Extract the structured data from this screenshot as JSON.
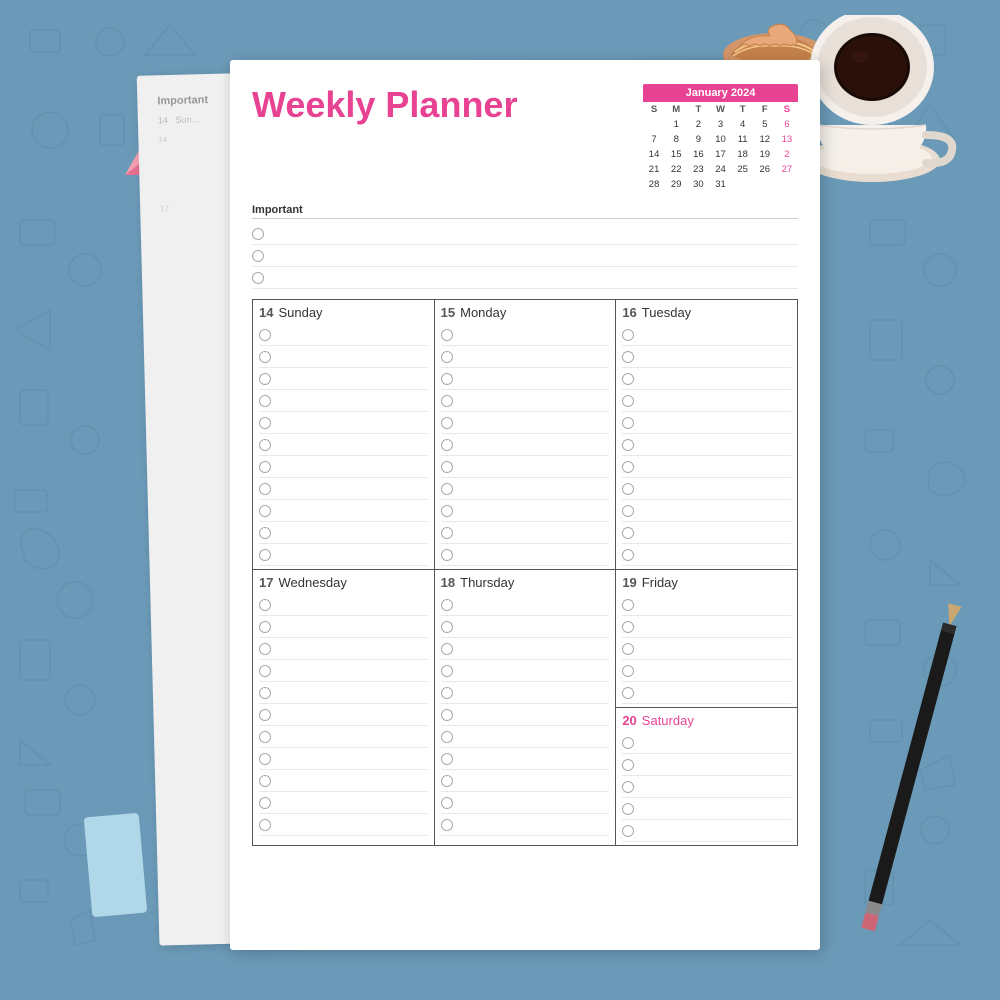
{
  "background": {
    "color": "#5f8fad"
  },
  "title": "Weekly Planner",
  "calendar": {
    "month": "January 2024",
    "days_header": [
      "S",
      "M",
      "T",
      "W",
      "T",
      "F",
      "S"
    ],
    "weeks": [
      [
        "",
        "1",
        "2",
        "3",
        "4",
        "5",
        "6"
      ],
      [
        "7",
        "8",
        "9",
        "10",
        "11",
        "12",
        "13"
      ],
      [
        "14",
        "15",
        "16",
        "17",
        "18",
        "19",
        "20"
      ],
      [
        "21",
        "22",
        "23",
        "24",
        "25",
        "26",
        "27"
      ],
      [
        "28",
        "29",
        "30",
        "31",
        "",
        "",
        ""
      ]
    ]
  },
  "important": {
    "label": "Important",
    "rows": 3
  },
  "days_row1": [
    {
      "number": "14",
      "name": "Sunday",
      "saturday": false
    },
    {
      "number": "15",
      "name": "Monday",
      "saturday": false
    },
    {
      "number": "16",
      "name": "Tuesday",
      "saturday": false
    }
  ],
  "days_row2": [
    {
      "number": "17",
      "name": "Wednesday",
      "saturday": false
    },
    {
      "number": "18",
      "name": "Thursday",
      "saturday": false
    },
    {
      "number": "19",
      "name": "Friday",
      "saturday": false
    }
  ],
  "saturday": {
    "number": "20",
    "name": "Saturday"
  },
  "rows_per_day": 11,
  "accent_color": "#e84393"
}
